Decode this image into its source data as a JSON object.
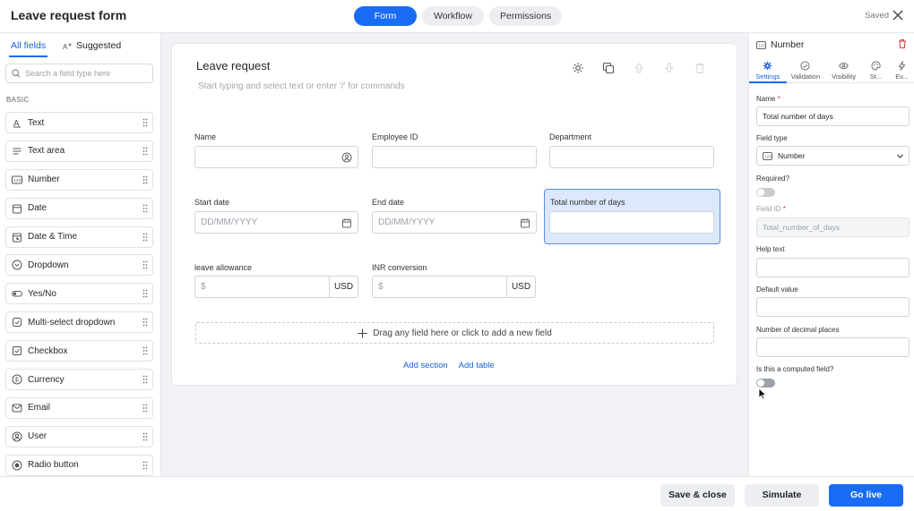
{
  "header": {
    "title": "Leave request form",
    "tabs": [
      {
        "label": "Form",
        "active": true
      },
      {
        "label": "Workflow",
        "active": false
      },
      {
        "label": "Permissions",
        "active": false
      }
    ],
    "saved_label": "Saved",
    "accent_color": "#1a6cf5"
  },
  "left_panel": {
    "tab_all": "All fields",
    "tab_suggested": "Suggested",
    "search_placeholder": "Search a field type here",
    "section_label": "BASIC",
    "fields": [
      {
        "label": "Text",
        "icon": "text-icon"
      },
      {
        "label": "Text area",
        "icon": "text-area-icon"
      },
      {
        "label": "Number",
        "icon": "number-icon"
      },
      {
        "label": "Date",
        "icon": "date-icon"
      },
      {
        "label": "Date & Time",
        "icon": "date-time-icon"
      },
      {
        "label": "Dropdown",
        "icon": "dropdown-icon"
      },
      {
        "label": "Yes/No",
        "icon": "toggle-icon"
      },
      {
        "label": "Multi-select dropdown",
        "icon": "multi-select-icon"
      },
      {
        "label": "Checkbox",
        "icon": "checkbox-icon"
      },
      {
        "label": "Currency",
        "icon": "currency-icon"
      },
      {
        "label": "Email",
        "icon": "email-icon"
      },
      {
        "label": "User",
        "icon": "user-icon"
      },
      {
        "label": "Radio button",
        "icon": "radio-icon"
      }
    ]
  },
  "canvas": {
    "title": "Leave request",
    "subtitle": "Start typing and select text or enter '/' for commands",
    "fields": {
      "name": {
        "label": "Name",
        "placeholder": ""
      },
      "employee_id": {
        "label": "Employee ID",
        "placeholder": ""
      },
      "department": {
        "label": "Department",
        "placeholder": ""
      },
      "start_date": {
        "label": "Start date",
        "placeholder": "DD/MM/YYYY"
      },
      "end_date": {
        "label": "End date",
        "placeholder": "DD/MM/YYYY"
      },
      "total_days": {
        "label": "Total number of days",
        "placeholder": ""
      },
      "leave_allowance": {
        "label": "leave allowance",
        "prefix": "$",
        "currency": "USD"
      },
      "inr_conversion": {
        "label": "INR conversion",
        "prefix": "$",
        "currency": "USD"
      }
    },
    "dropzone_text": "Drag any field here or click to add a new field",
    "add_section": "Add section",
    "add_table": "Add table"
  },
  "right_panel": {
    "title": "Number",
    "tabs": [
      "Settings",
      "Validation",
      "Visibility",
      "St...",
      "Ev..."
    ],
    "name_label": "Name",
    "name_value": "Total number of days",
    "field_type_label": "Field type",
    "field_type_value": "Number",
    "required_label": "Required?",
    "field_id_label": "Field ID",
    "field_id_value": "Total_number_of_days",
    "help_text_label": "Help text",
    "help_text_value": "",
    "default_value_label": "Default value",
    "default_value": "",
    "decimal_label": "Number of decimal places",
    "decimal_value": "",
    "computed_label": "Is this a computed field?"
  },
  "footer": {
    "save_close": "Save & close",
    "simulate": "Simulate",
    "go_live": "Go live"
  }
}
